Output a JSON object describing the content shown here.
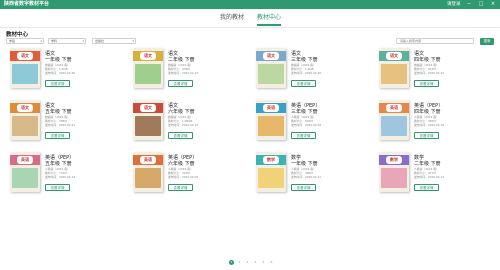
{
  "window": {
    "title": "陕西省数字教材平台",
    "login": "请登录",
    "controls": [
      "−",
      "□",
      "×"
    ]
  },
  "tabs": [
    {
      "label": "我的教材",
      "active": false
    },
    {
      "label": "教材中心",
      "active": true
    }
  ],
  "section_title": "教材中心",
  "filters": [
    {
      "value": "学段",
      "icon": "chevron-down-icon"
    },
    {
      "value": "学科",
      "icon": "chevron-down-icon"
    },
    {
      "value": "出版社",
      "icon": "chevron-down-icon"
    }
  ],
  "search": {
    "placeholder": "请输入搜索内容",
    "button": "搜索"
  },
  "detail_label": "查看详情",
  "books": [
    {
      "subject": "语文",
      "grade": "一年级 下册",
      "pub": "统编版（2019 版）",
      "size": "教材大小：1.3GB",
      "date": "发布时间：2020.02.26",
      "cover": "chinese",
      "cover_text": "语文",
      "band": "#e25b3a",
      "scene": "#8ec9d8"
    },
    {
      "subject": "语文",
      "grade": "二年级 下册",
      "pub": "统编版（2019 版）",
      "size": "教材大小：978M",
      "date": "发布时间：2020.02.13",
      "cover": "chinese",
      "cover_text": "语文",
      "band": "#d9b03a",
      "scene": "#9fce8e"
    },
    {
      "subject": "语文",
      "grade": "三年级 下册",
      "pub": "统编版（2019 版）",
      "size": "教材大小：1.6GB",
      "date": "发布时间：2020.02.20",
      "cover": "chinese",
      "cover_text": "语文",
      "band": "#7aa9cf",
      "scene": "#bcd7a0"
    },
    {
      "subject": "语文",
      "grade": "四年级 下册",
      "pub": "统编版（2019 版）",
      "size": "教材大小：915M",
      "date": "发布时间：2020.02.22",
      "cover": "chinese",
      "cover_text": "语文",
      "band": "#5bb0a0",
      "scene": "#e6c27e"
    },
    {
      "subject": "语文",
      "grade": "五年级 下册",
      "pub": "统编版（2019 版）",
      "size": "教材大小：758M",
      "date": "发布时间：2020.02.21",
      "cover": "chinese",
      "cover_text": "语文",
      "band": "#e08a3a",
      "scene": "#d7b98a"
    },
    {
      "subject": "语文",
      "grade": "六年级 下册",
      "pub": "统编版（2019 版）",
      "size": "教材大小：1.08GB",
      "date": "发布时间：2020.02.23",
      "cover": "chinese",
      "cover_text": "语文",
      "band": "#c94b3e",
      "scene": "#a07a5a"
    },
    {
      "subject": "英语（PEP）",
      "grade": "三年级 下册",
      "pub": "人教版（2019 版）",
      "size": "教材大小：500M",
      "date": "发布时间：2020.02.09",
      "cover": "english",
      "cover_text": "英语",
      "band": "#3aa0c9",
      "scene": "#e8b86a"
    },
    {
      "subject": "英语（PEP）",
      "grade": "四年级 下册",
      "pub": "人教版（2019 版）",
      "size": "教材大小：382M",
      "date": "发布时间：2020.02.18",
      "cover": "english",
      "cover_text": "英语",
      "band": "#e8864a",
      "scene": "#9ec6df"
    },
    {
      "subject": "英语（PEP）",
      "grade": "五年级 下册",
      "pub": "人教版（2019 版）",
      "size": "教材大小：772M",
      "date": "发布时间：2020.02.14",
      "cover": "english",
      "cover_text": "英语",
      "band": "#d96a8a",
      "scene": "#a8d6b0"
    },
    {
      "subject": "英语（PEP）",
      "grade": "六年级 下册",
      "pub": "人教版（2019 版）",
      "size": "教材大小：315M",
      "date": "发布时间：2020.02.09",
      "cover": "english",
      "cover_text": "英语",
      "band": "#e0703a",
      "scene": "#d6a86a"
    },
    {
      "subject": "数学",
      "grade": "一年级 下册",
      "pub": "人教版（2019 版）",
      "size": "教材大小：460M",
      "date": "发布时间：2020.02.21",
      "cover": "math",
      "cover_text": "数学",
      "band": "#3ab4b0",
      "scene": "#f0d278"
    },
    {
      "subject": "数学",
      "grade": "二年级 下册",
      "pub": "人教版（2019 版）",
      "size": "教材大小：477M",
      "date": "发布时间：2020.02.13",
      "cover": "math",
      "cover_text": "数学",
      "band": "#8a6cc9",
      "scene": "#e9a6b8"
    }
  ],
  "pagination": {
    "pages": [
      "1",
      "2",
      "3",
      "4",
      "5",
      "6"
    ],
    "current": "1"
  },
  "colors": {
    "primary": "#2f9a70"
  }
}
